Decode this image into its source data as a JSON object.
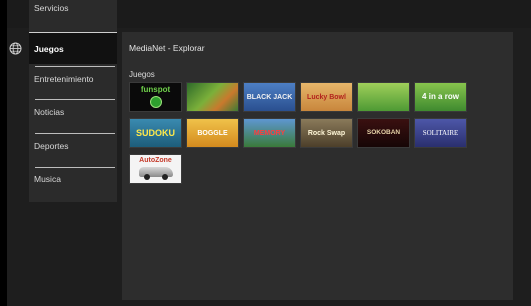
{
  "sidebar": {
    "items": [
      {
        "label": "Servicios"
      },
      {
        "label": "Juegos"
      },
      {
        "label": "Entretenimiento"
      },
      {
        "label": "Noticias"
      },
      {
        "label": "Deportes"
      },
      {
        "label": "Musica"
      }
    ]
  },
  "main": {
    "title": "MediaNet - Explorar",
    "section_label": "Juegos",
    "games": [
      {
        "name": "funspot"
      },
      {
        "name": ""
      },
      {
        "name": "BLACK JACK"
      },
      {
        "name": "Lucky Bowl"
      },
      {
        "name": ""
      },
      {
        "name": "4 in a row"
      },
      {
        "name": "SUDOKU"
      },
      {
        "name": "BOGGLE"
      },
      {
        "name": "MEMORY"
      },
      {
        "name": "Rock Swap"
      },
      {
        "name": "SOKOBAN"
      },
      {
        "name": "SOLITAIRE"
      },
      {
        "name": "AutoZone"
      }
    ]
  },
  "icons": {
    "globe": "globe-icon"
  }
}
